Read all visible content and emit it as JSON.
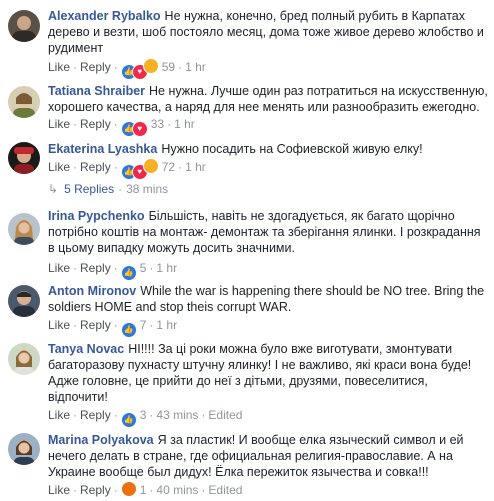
{
  "labels": {
    "like": "Like",
    "reply": "Reply",
    "dot": "·",
    "edited": "Edited"
  },
  "comments": [
    {
      "author": "Alexander Rybalko",
      "text": "Не нужна, конечно, бред полный рубить в Карпатах дерево и везти, шоб постояло месяц, дома тоже живое дерево жлобство и рудимент",
      "reactions": [
        "like",
        "love",
        "haha"
      ],
      "count": "59",
      "time": "1 hr",
      "edited": ""
    },
    {
      "author": "Tatiana Shraiber",
      "text": "Не нужна. Лучше один раз потратиться на искусственную, хорошего качества, а наряд для нее менять или разнообразить ежегодно.",
      "reactions": [
        "like",
        "love"
      ],
      "count": "33",
      "time": "1 hr",
      "edited": ""
    },
    {
      "author": "Ekaterina Lyashka",
      "text": "Нужно посадить на Софиевской живую елку!",
      "reactions": [
        "like",
        "love",
        "haha"
      ],
      "count": "72",
      "time": "1 hr",
      "edited": "",
      "replies": {
        "label": "5 Replies",
        "time": "38 mins"
      }
    },
    {
      "author": "Irina Pypchenko",
      "text": "Більшість, навіть не здогадується, як багато щорічно потрібно коштів на монтаж- демонтаж та зберігання ялинки. І розкрадання в цьому випадку можуть досить значними.",
      "reactions": [
        "like"
      ],
      "count": "5",
      "time": "1 hr",
      "edited": ""
    },
    {
      "author": "Anton Mironov",
      "text": "While the war is happening there should be NO tree. Bring the soldiers HOME and stop theis corrupt WAR.",
      "reactions": [
        "like"
      ],
      "count": "7",
      "time": "1 hr",
      "edited": ""
    },
    {
      "author": "Tanya Novac",
      "text": "HI!!!! За ці роки можна було вже виготувати, змонтувати багаторазову пухнасту штучну ялинку! І не важливо, які краси вона буде! Адже головне, це прийти до неї з дітьми, друзями, повеселитися, відпочити!",
      "reactions": [
        "like"
      ],
      "count": "3",
      "time": "43 mins",
      "edited": "Edited"
    },
    {
      "author": "Marina Polyakova",
      "text": "Я за пластик! И вообще елка языческий символ и ей нечего делать в стране, где официальная религия-православие. А на Украине вообще был дидух! Ёлка пережиток язычества и совка!!!",
      "reactions": [
        "angry"
      ],
      "count": "1",
      "time": "40 mins",
      "edited": "Edited"
    }
  ],
  "colors": {
    "author": "#365899",
    "meta": "#90949c",
    "like": "#2b78e4",
    "love": "#f0284a",
    "haha": "#f7b125",
    "angry": "#e9710f"
  }
}
